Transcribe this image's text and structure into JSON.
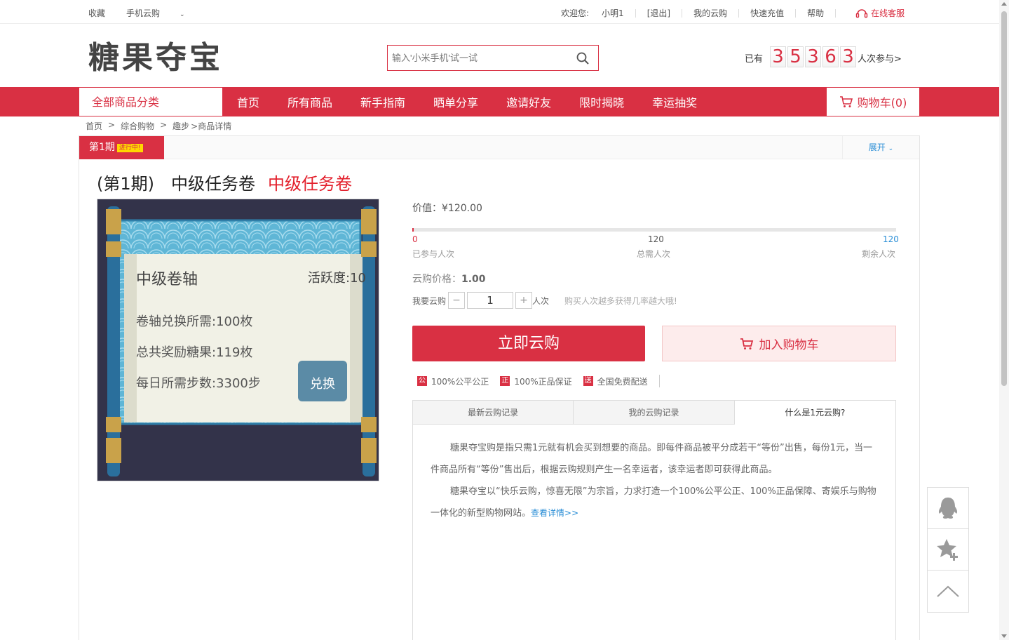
{
  "topbar": {
    "favorite": "收藏",
    "mobile": "手机云购",
    "welcome": "欢迎您:",
    "username": "小明1",
    "logout": "[退出]",
    "my_purchases": "我的云购",
    "recharge": "快速充值",
    "help": "帮助",
    "service": "在线客服"
  },
  "header": {
    "logo": "糖果夺宝",
    "search_placeholder": "输入'小米手机'试一试",
    "counter_prefix": "已有",
    "counter_digits": [
      "3",
      "5",
      "3",
      "6",
      "3"
    ],
    "counter_suffix": "人次参与>"
  },
  "nav": {
    "category": "全部商品分类",
    "items": [
      "首页",
      "所有商品",
      "新手指南",
      "晒单分享",
      "邀请好友",
      "限时揭晓",
      "幸运抽奖"
    ],
    "cart": "购物车(0)"
  },
  "breadcrumb": [
    "首页",
    ">",
    "综合购物",
    ">",
    "趣步",
    ">商品详情"
  ],
  "product": {
    "period": "第1期",
    "period_badge": "进行中!",
    "expand": "展开",
    "title": "(第1期)　中级任务卷",
    "title_highlight": "中级任务卷",
    "image": {
      "heading": "中级卷轴",
      "activity": "活跃度:10",
      "line1": "卷轴兑换所需:100枚",
      "line2": "总共奖励糖果:119枚",
      "line3": "每日所需步数:3300步",
      "button": "兑换"
    },
    "price_label": "价值：¥120.00",
    "progress": {
      "joined": "0",
      "total": "120",
      "remaining": "120",
      "joined_label": "已参与人次",
      "total_label": "总需人次",
      "remaining_label": "剩余人次",
      "fraction": 0.002
    },
    "cloud_price_label": "云购价格：",
    "cloud_price": "1.00",
    "qty_label": "我要云购",
    "qty_minus": "−",
    "qty_value": "1",
    "qty_plus": "+",
    "qty_unit": "人次",
    "qty_tip": "购买人次越多获得几率越大哦!",
    "buy_now": "立即云购",
    "add_cart": "加入购物车",
    "guarantees": [
      {
        "icon": "公",
        "text": "100%公平公正"
      },
      {
        "icon": "正",
        "text": "100%正品保证"
      },
      {
        "icon": "送",
        "text": "全国免费配送"
      }
    ]
  },
  "tabs": {
    "items": [
      "最新云购记录",
      "我的云购记录",
      "什么是1元云购?"
    ],
    "p1": "糖果夺宝购是指只需1元就有机会买到想要的商品。即每件商品被平分成若干“等份”出售，每份1元，当一件商品所有“等份”售出后，根据云购规则产生一名幸运者，该幸运者即可获得此商品。",
    "p2": "糖果夺宝以“快乐云购，惊喜无限”为宗旨，力求打造一个100%公平公正、100%正品保障、寄娱乐与购物一体化的新型购物网站。",
    "more": "查看详情>>"
  },
  "colors": {
    "brand": "#d93043",
    "link": "#2a8ed6"
  }
}
